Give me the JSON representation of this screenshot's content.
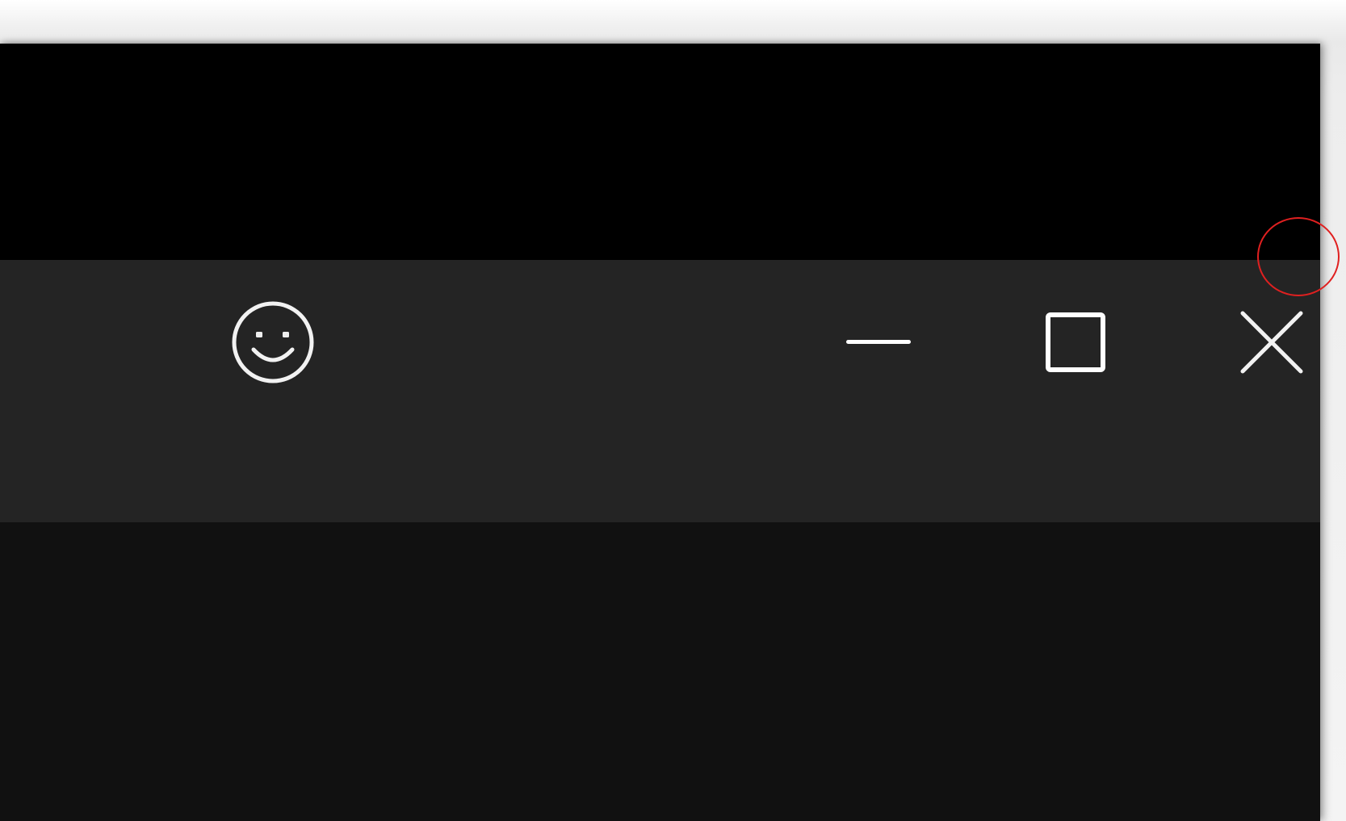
{
  "window": {
    "titlebar": {
      "buttons": [
        {
          "name": "emoji",
          "icon": "smiley-face-icon"
        },
        {
          "name": "minimize",
          "icon": "minimize-icon"
        },
        {
          "name": "maximize",
          "icon": "maximize-icon"
        },
        {
          "name": "close",
          "icon": "close-icon"
        }
      ]
    }
  },
  "colors": {
    "top_area": "#000000",
    "titlebar": "#242424",
    "content": "#111111",
    "icon": "#ffffff",
    "annotation": "#e02020"
  }
}
